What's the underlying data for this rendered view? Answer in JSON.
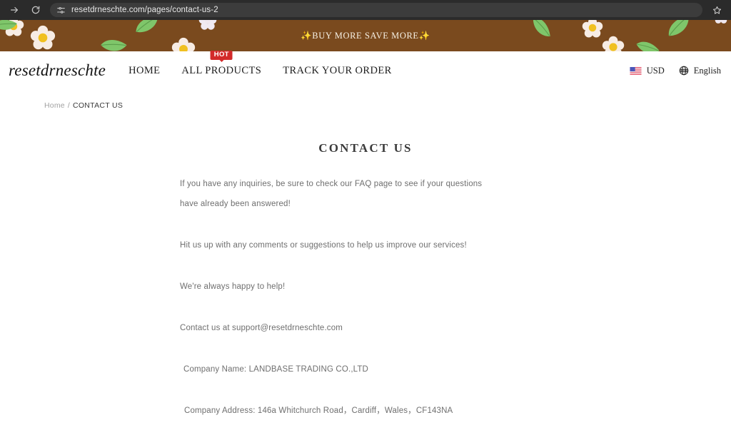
{
  "browser": {
    "url": "resetdrneschte.com/pages/contact-us-2",
    "forward_icon": "forward-arrow-icon",
    "reload_icon": "reload-icon",
    "site_settings_icon": "site-settings-icon",
    "bookmark_icon": "star-icon",
    "chrome_bg": "#2b2b2b",
    "omnibox_bg": "#3c3c3c"
  },
  "promo": {
    "text": "✨BUY MORE SAVE MORE✨",
    "bg_color": "#7a4a1e",
    "text_color": "#f5efe3",
    "flower_petal_color": "#f7ece4",
    "flower_center_color": "#f0c020",
    "leaf_color": "#7fc66a"
  },
  "header": {
    "logo": "resetdrneschte",
    "nav": [
      {
        "label": "HOME",
        "badge": null
      },
      {
        "label": "ALL PRODUCTS",
        "badge": "HOT"
      },
      {
        "label": "TRACK YOUR ORDER",
        "badge": null
      }
    ],
    "currency": {
      "label": "USD",
      "icon": "us-flag-icon"
    },
    "language": {
      "label": "English",
      "icon": "globe-icon"
    },
    "badge_color": "#d32a2a"
  },
  "breadcrumb": {
    "home": "Home",
    "separator": "/",
    "current": "CONTACT US"
  },
  "main": {
    "title": "CONTACT US",
    "paragraphs": [
      "If you have any inquiries, be sure to check our FAQ page to see if your questions",
      "have already been answered!",
      "Hit us up with any comments or suggestions to help us improve our services!",
      "We're always happy to help!",
      "Contact us at support@resetdrneschte.com",
      "Company Name: LANDBASE TRADING CO.,LTD",
      "Company Address: 146a Whitchurch Road，Cardiff，Wales，CF143NA"
    ]
  }
}
